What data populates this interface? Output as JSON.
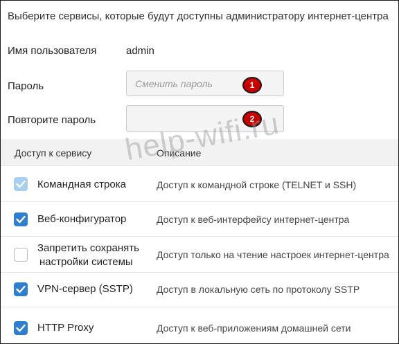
{
  "intro": "Выберите сервисы, которые будут доступны администратору интернет-центра",
  "user": {
    "label": "Имя пользователя",
    "value": "admin"
  },
  "password": {
    "label": "Пароль",
    "placeholder": "Сменить пароль",
    "badge": "1"
  },
  "repeat": {
    "label": "Повторите пароль",
    "placeholder": "",
    "badge": "2"
  },
  "table": {
    "headers": {
      "access": "Доступ к сервису",
      "description": "Описание"
    },
    "rows": [
      {
        "name": "Командная строка",
        "description": "Доступ к командной строке (TELNET и SSH)",
        "checked": true,
        "disabled": true
      },
      {
        "name": "Веб-конфигуратор",
        "description": "Доступ к веб-интерфейсу интернет-центра",
        "checked": true,
        "disabled": false
      },
      {
        "name_line1": "Запретить сохранять",
        "name_line2": "настройки системы",
        "description": "Доступ только на чтение настроек интернет-центра",
        "checked": false,
        "disabled": false
      },
      {
        "name": "VPN-сервер (SSTP)",
        "description": "Доступ в локальную сеть по протоколу SSTP",
        "checked": true,
        "disabled": false
      },
      {
        "name": "HTTP Proxy",
        "description": "Доступ к веб-приложениям домашней сети",
        "checked": true,
        "disabled": false
      }
    ]
  },
  "watermark": "help-wifi.ru",
  "colors": {
    "checkbox_on": "#2f7fd0",
    "checkbox_disabled": "#a9cff0",
    "badge": "#c80000"
  }
}
